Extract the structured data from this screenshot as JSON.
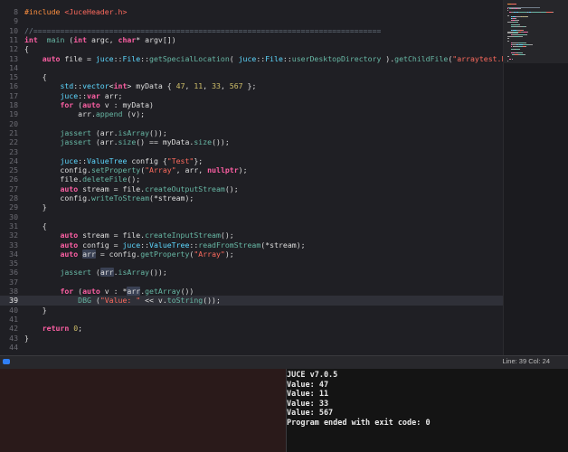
{
  "editor": {
    "current_line": 39,
    "lines": [
      {
        "n": "8",
        "t": [
          [
            "pp",
            "#include "
          ],
          [
            "str",
            "<JuceHeader.h>"
          ]
        ]
      },
      {
        "n": "9",
        "t": []
      },
      {
        "n": "10",
        "t": [
          [
            "cm",
            "//=============================================================================="
          ]
        ]
      },
      {
        "n": "11",
        "t": [
          [
            "kw",
            "int"
          ],
          [
            "",
            "  "
          ],
          [
            "fn",
            "main"
          ],
          [
            "",
            " ("
          ],
          [
            "kw",
            "int"
          ],
          [
            "",
            " argc, "
          ],
          [
            "kw",
            "char"
          ],
          [
            "",
            "* argv[])"
          ]
        ]
      },
      {
        "n": "12",
        "t": [
          [
            "",
            "{"
          ]
        ]
      },
      {
        "n": "13",
        "t": [
          [
            "",
            "    "
          ],
          [
            "kw",
            "auto"
          ],
          [
            "",
            " file = "
          ],
          [
            "ty",
            "juce"
          ],
          [
            "",
            "::"
          ],
          [
            "ty",
            "File"
          ],
          [
            "",
            "::"
          ],
          [
            "fn",
            "getSpecialLocation"
          ],
          [
            "",
            "( "
          ],
          [
            "ty",
            "juce"
          ],
          [
            "",
            "::"
          ],
          [
            "ty",
            "File"
          ],
          [
            "",
            "::"
          ],
          [
            "fn",
            "userDesktopDirectory"
          ],
          [
            "",
            " )."
          ],
          [
            "fn",
            "getChildFile"
          ],
          [
            "",
            "("
          ],
          [
            "str",
            "\"arraytest.bin\""
          ],
          [
            "",
            ");"
          ]
        ]
      },
      {
        "n": "14",
        "t": []
      },
      {
        "n": "15",
        "t": [
          [
            "",
            "    {"
          ]
        ]
      },
      {
        "n": "16",
        "t": [
          [
            "",
            "        "
          ],
          [
            "ty",
            "std"
          ],
          [
            "",
            "::"
          ],
          [
            "ty",
            "vector"
          ],
          [
            "",
            "<"
          ],
          [
            "kw",
            "int"
          ],
          [
            "",
            "> myData { "
          ],
          [
            "num",
            "47"
          ],
          [
            "",
            ", "
          ],
          [
            "num",
            "11"
          ],
          [
            "",
            ", "
          ],
          [
            "num",
            "33"
          ],
          [
            "",
            ", "
          ],
          [
            "num",
            "567"
          ],
          [
            "",
            " };"
          ]
        ]
      },
      {
        "n": "17",
        "t": [
          [
            "",
            "        "
          ],
          [
            "ty",
            "juce"
          ],
          [
            "",
            "::"
          ],
          [
            "kw",
            "var"
          ],
          [
            "",
            " arr;"
          ]
        ]
      },
      {
        "n": "18",
        "t": [
          [
            "",
            "        "
          ],
          [
            "kw",
            "for"
          ],
          [
            "",
            " ("
          ],
          [
            "kw",
            "auto"
          ],
          [
            "",
            " v : myData)"
          ]
        ]
      },
      {
        "n": "19",
        "t": [
          [
            "",
            "            arr."
          ],
          [
            "fn",
            "append"
          ],
          [
            "",
            " (v);"
          ]
        ]
      },
      {
        "n": "20",
        "t": []
      },
      {
        "n": "21",
        "t": [
          [
            "",
            "        "
          ],
          [
            "fn",
            "jassert"
          ],
          [
            "",
            " (arr."
          ],
          [
            "fn",
            "isArray"
          ],
          [
            "",
            "());"
          ]
        ]
      },
      {
        "n": "22",
        "t": [
          [
            "",
            "        "
          ],
          [
            "fn",
            "jassert"
          ],
          [
            "",
            " (arr."
          ],
          [
            "fn",
            "size"
          ],
          [
            "",
            "() == myData."
          ],
          [
            "fn",
            "size"
          ],
          [
            "",
            "());"
          ]
        ]
      },
      {
        "n": "23",
        "t": []
      },
      {
        "n": "24",
        "t": [
          [
            "",
            "        "
          ],
          [
            "ty",
            "juce"
          ],
          [
            "",
            "::"
          ],
          [
            "ty",
            "ValueTree"
          ],
          [
            "",
            " config {"
          ],
          [
            "str",
            "\"Test\""
          ],
          [
            "",
            "};"
          ]
        ]
      },
      {
        "n": "25",
        "t": [
          [
            "",
            "        config."
          ],
          [
            "fn",
            "setProperty"
          ],
          [
            "",
            "("
          ],
          [
            "str",
            "\"Array\""
          ],
          [
            "",
            ", arr, "
          ],
          [
            "kw",
            "nullptr"
          ],
          [
            "",
            ");"
          ]
        ]
      },
      {
        "n": "26",
        "t": [
          [
            "",
            "        file."
          ],
          [
            "fn",
            "deleteFile"
          ],
          [
            "",
            "();"
          ]
        ]
      },
      {
        "n": "27",
        "t": [
          [
            "",
            "        "
          ],
          [
            "kw",
            "auto"
          ],
          [
            "",
            " stream = file."
          ],
          [
            "fn",
            "createOutputStream"
          ],
          [
            "",
            "();"
          ]
        ]
      },
      {
        "n": "28",
        "t": [
          [
            "",
            "        config."
          ],
          [
            "fn",
            "writeToStream"
          ],
          [
            "",
            "(*stream);"
          ]
        ]
      },
      {
        "n": "29",
        "t": [
          [
            "",
            "    }"
          ]
        ]
      },
      {
        "n": "30",
        "t": []
      },
      {
        "n": "31",
        "t": [
          [
            "",
            "    {"
          ]
        ]
      },
      {
        "n": "32",
        "t": [
          [
            "",
            "        "
          ],
          [
            "kw",
            "auto"
          ],
          [
            "",
            " stream = file."
          ],
          [
            "fn",
            "createInputStream"
          ],
          [
            "",
            "();"
          ]
        ]
      },
      {
        "n": "33",
        "t": [
          [
            "",
            "        "
          ],
          [
            "kw",
            "auto"
          ],
          [
            "",
            " config = "
          ],
          [
            "ty",
            "juce"
          ],
          [
            "",
            "::"
          ],
          [
            "ty",
            "ValueTree"
          ],
          [
            "",
            "::"
          ],
          [
            "fn",
            "readFromStream"
          ],
          [
            "",
            "(*stream);"
          ]
        ]
      },
      {
        "n": "34",
        "t": [
          [
            "",
            "        "
          ],
          [
            "kw",
            "auto"
          ],
          [
            "",
            " "
          ],
          [
            "hl",
            "arr"
          ],
          [
            "",
            " = config."
          ],
          [
            "fn",
            "getProperty"
          ],
          [
            "",
            "("
          ],
          [
            "str",
            "\"Array\""
          ],
          [
            "",
            ");"
          ]
        ]
      },
      {
        "n": "35",
        "t": []
      },
      {
        "n": "36",
        "t": [
          [
            "",
            "        "
          ],
          [
            "fn",
            "jassert"
          ],
          [
            "",
            " ("
          ],
          [
            "hl",
            "arr"
          ],
          [
            "",
            "."
          ],
          [
            "fn",
            "isArray"
          ],
          [
            "",
            "());"
          ]
        ]
      },
      {
        "n": "37",
        "t": []
      },
      {
        "n": "38",
        "t": [
          [
            "",
            "        "
          ],
          [
            "kw",
            "for"
          ],
          [
            "",
            " ("
          ],
          [
            "kw",
            "auto"
          ],
          [
            "",
            " v : *"
          ],
          [
            "hl",
            "arr"
          ],
          [
            "",
            "."
          ],
          [
            "fn",
            "getArray"
          ],
          [
            "",
            "())"
          ]
        ]
      },
      {
        "n": "39",
        "t": [
          [
            "",
            "            "
          ],
          [
            "fn",
            "DBG"
          ],
          [
            "",
            " ("
          ],
          [
            "str",
            "\"Value: \""
          ],
          [
            "",
            " << v."
          ],
          [
            "fn",
            "toString"
          ],
          [
            "",
            "());"
          ]
        ]
      },
      {
        "n": "40",
        "t": [
          [
            "",
            "    }"
          ]
        ]
      },
      {
        "n": "41",
        "t": []
      },
      {
        "n": "42",
        "t": [
          [
            "",
            "    "
          ],
          [
            "kw",
            "return"
          ],
          [
            "",
            " "
          ],
          [
            "num",
            "0"
          ],
          [
            "",
            ";"
          ]
        ]
      },
      {
        "n": "43",
        "t": [
          [
            "",
            "}"
          ]
        ]
      },
      {
        "n": "44",
        "t": []
      }
    ]
  },
  "colors": {
    "keyword": "#fc5fa3",
    "string": "#fc6a5d",
    "number": "#d0bf69",
    "type": "#5dd8ff",
    "function": "#67b7a4",
    "preprocessor": "#fd8f3f",
    "comment": "#6c7986",
    "debug_toggle": "#2f7ff5"
  },
  "statusbar": {
    "position": "Line: 39  Col: 24"
  },
  "console": {
    "lines": [
      "JUCE v7.0.5",
      "Value: 47",
      "Value: 11",
      "Value: 33",
      "Value: 567",
      "Program ended with exit code: 0"
    ]
  }
}
